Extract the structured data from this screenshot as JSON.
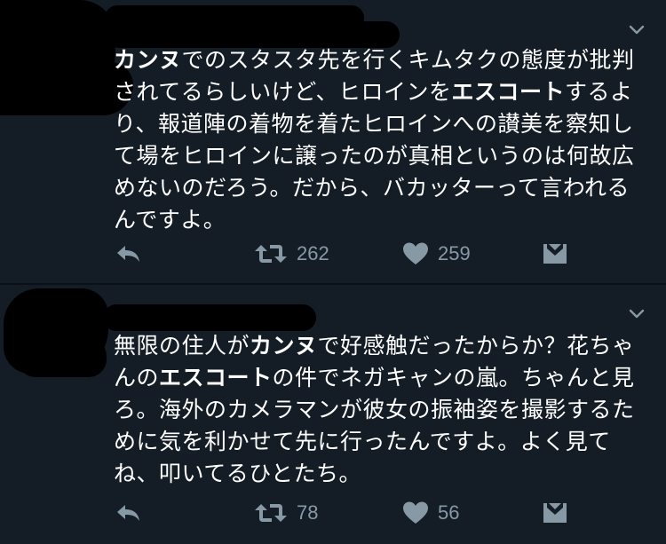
{
  "tweets": [
    {
      "text_parts": [
        {
          "t": "カンヌ",
          "b": true
        },
        {
          "t": "でのスタスタ先を行くキムタクの態度が批判\nされてるらしいけど、ヒロインを",
          "b": false
        },
        {
          "t": "エスコート",
          "b": true
        },
        {
          "t": "するよ\nり、報道陣の着物を着たヒロインへの讃美を察知し\nて場をヒロインに譲ったのが真相というのは何故広\nめないのだろう。だから、バカッターって言われる\nんですよ。",
          "b": false
        }
      ],
      "retweet_count": "262",
      "like_count": "259"
    },
    {
      "text_parts": [
        {
          "t": "無限の住人が",
          "b": false
        },
        {
          "t": "カンヌ",
          "b": true
        },
        {
          "t": "で好感触だったからか？花ちゃ\nんの",
          "b": false
        },
        {
          "t": "エスコート",
          "b": true
        },
        {
          "t": "の件でネガキャンの嵐。ちゃんと見\nろ。海外のカメラマンが彼女の振袖姿を撮影するた\nめに気を利かせて先に行ったんですよ。よく見て\nね、叩いてるひとたち。",
          "b": false
        }
      ],
      "retweet_count": "78",
      "like_count": "56"
    }
  ],
  "icons": {
    "reply": "reply-arrow-icon",
    "retweet": "retweet-icon",
    "like": "heart-icon",
    "dm": "direct-message-icon",
    "caret": "chevron-down-icon"
  },
  "colors": {
    "background": "#141d26",
    "text": "#ffffff",
    "icon": "#8899a6"
  }
}
